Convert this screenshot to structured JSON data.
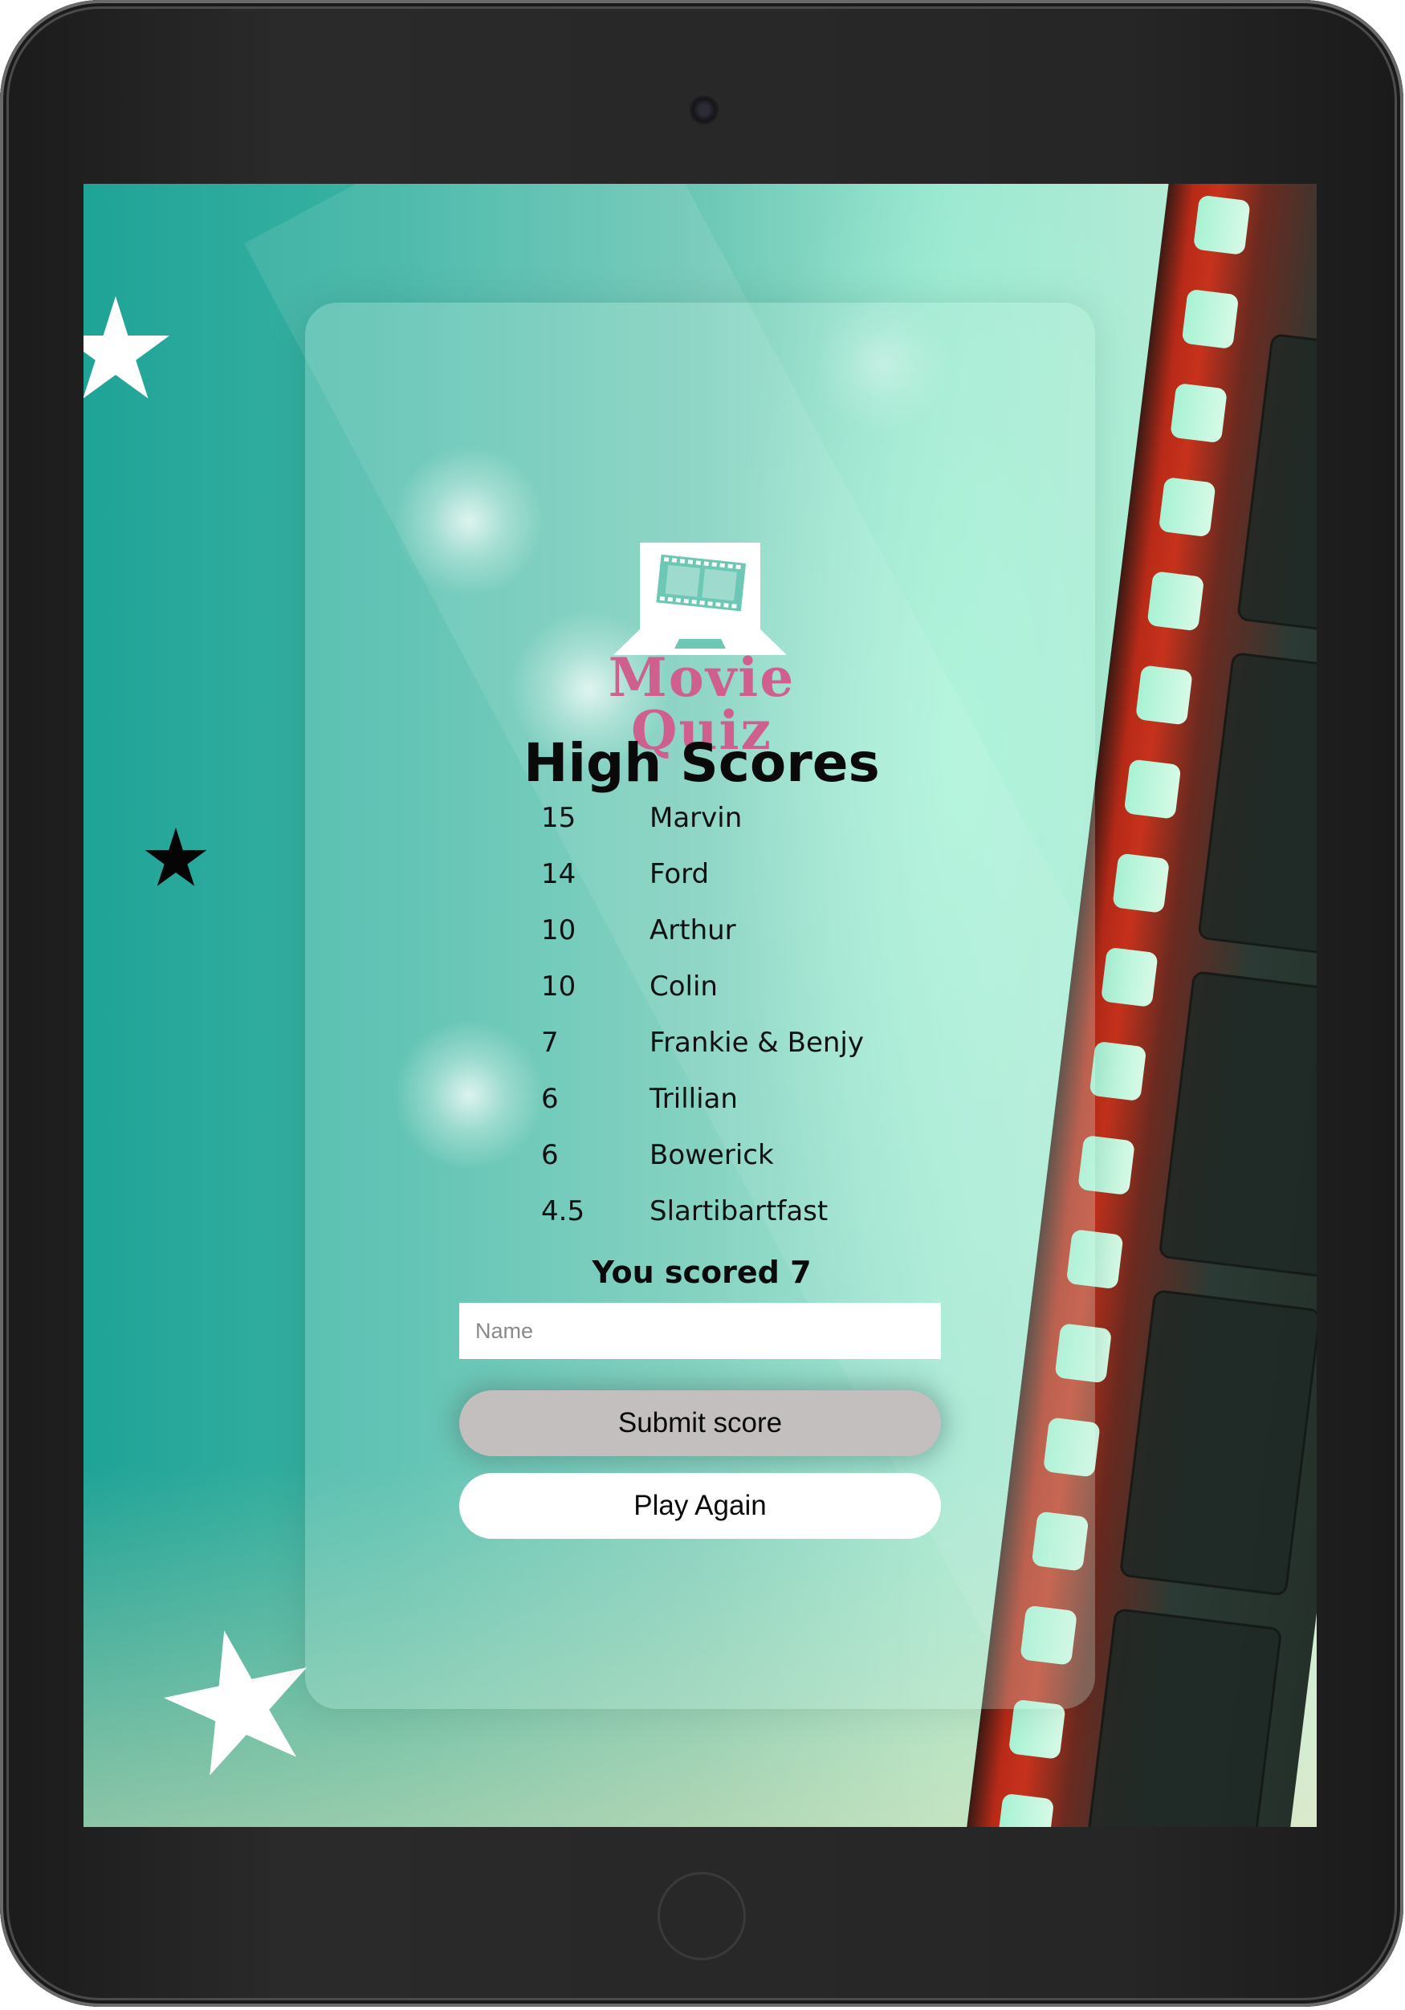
{
  "app": {
    "brand_name": "Movie Quiz",
    "logo_icon": "laptop-film-icon"
  },
  "high_scores": {
    "title": "High Scores",
    "rows": [
      {
        "score": "15",
        "name": "Marvin"
      },
      {
        "score": "14",
        "name": "Ford"
      },
      {
        "score": "10",
        "name": "Arthur"
      },
      {
        "score": "10",
        "name": "Colin"
      },
      {
        "score": "7",
        "name": "Frankie & Benjy"
      },
      {
        "score": "6",
        "name": "Trillian"
      },
      {
        "score": "6",
        "name": "Bowerick"
      },
      {
        "score": "4.5",
        "name": "Slartibartfast"
      }
    ]
  },
  "result": {
    "text": "You scored 7"
  },
  "form": {
    "name_placeholder": "Name",
    "name_value": "",
    "submit_label": "Submit score",
    "play_again_label": "Play Again"
  },
  "colors": {
    "brand": "#cf5f8f",
    "teal_dark": "#1fa397",
    "mint": "#9ae6cf",
    "film_red": "#c7321c",
    "submit_bg": "#c3bfbf"
  },
  "decor_icons": [
    "star-icon",
    "film-strip-icon"
  ]
}
